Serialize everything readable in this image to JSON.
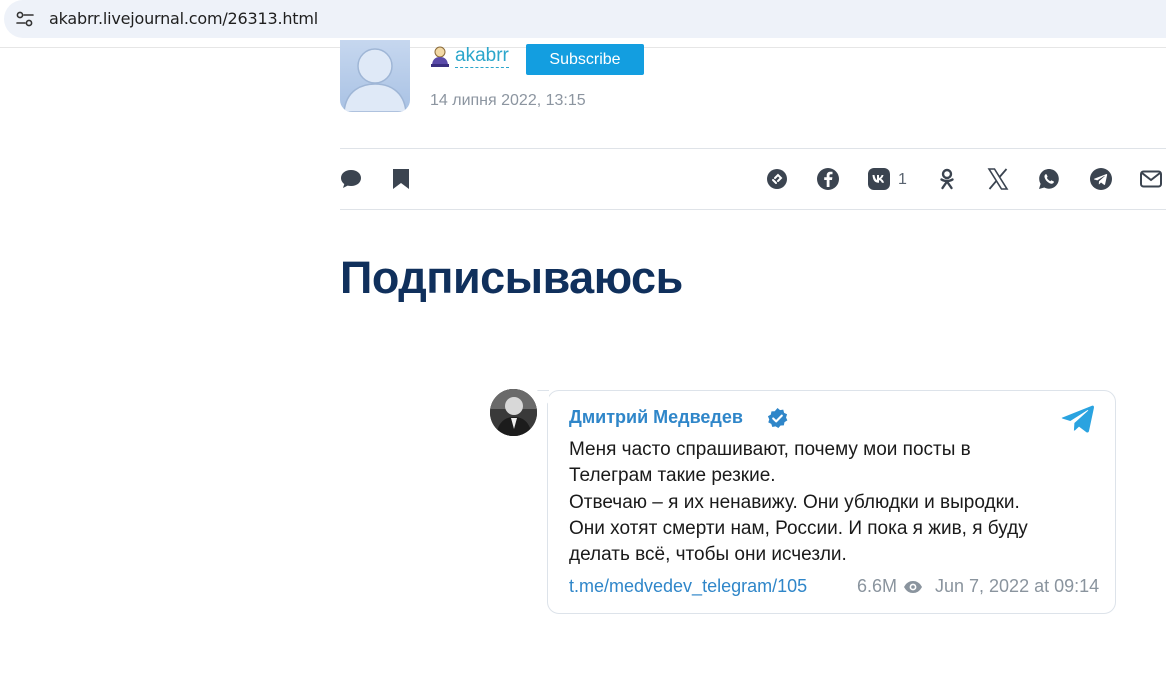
{
  "browser": {
    "url": "akabrr.livejournal.com/26313.html"
  },
  "author": {
    "username": "akabrr",
    "subscribe_label": "Subscribe",
    "date": "14 липня 2022, 13:15"
  },
  "share": {
    "vk_count": "1",
    "icons": [
      "comment-icon",
      "bookmark-icon",
      "copy-link-icon",
      "facebook-icon",
      "vk-icon",
      "odnoklassniki-icon",
      "x-icon",
      "whatsapp-icon",
      "telegram-share-icon",
      "email-icon"
    ]
  },
  "post": {
    "title": "Подписываюсь"
  },
  "telegram": {
    "channel_name": "Дмитрий Медведев",
    "message_lines": [
      "Меня часто спрашивают, почему мои посты в",
      "Телеграм такие резкие.",
      "Отвечаю – я их ненавижу. Они ублюдки и выродки.",
      "Они хотят смерти нам, России. И пока я жив, я буду",
      "делать всё, чтобы они исчезли."
    ],
    "link": "t.me/medvedev_telegram/105",
    "views": "6.6M",
    "date": "Jun 7, 2022 at 09:14"
  },
  "colors": {
    "accent": "#139ee0",
    "link": "#2ba6cb",
    "title": "#10305c",
    "telegram": "#2f86c9"
  }
}
